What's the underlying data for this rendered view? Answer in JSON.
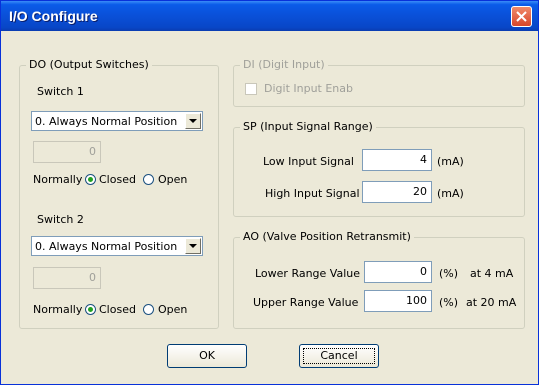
{
  "window": {
    "title": "I/O Configure"
  },
  "do_group": {
    "legend": "DO (Output Switches)",
    "switch1": {
      "label": "Switch 1",
      "selected": "0. Always Normal Position",
      "value": "0"
    },
    "switch2": {
      "label": "Switch 2",
      "selected": "0. Always Normal Position",
      "value": "0"
    },
    "normally_label": "Normally",
    "closed_label": "Closed",
    "open_label": "Open"
  },
  "di_group": {
    "legend": "DI (Digit Input)",
    "checkbox_label": "Digit Input Enab"
  },
  "sp_group": {
    "legend": "SP (Input Signal Range)",
    "low_label": "Low Input Signal",
    "low_value": "4",
    "low_unit": "(mA)",
    "high_label": "High Input Signal",
    "high_value": "20",
    "high_unit": "(mA)"
  },
  "ao_group": {
    "legend": "AO (Valve Position Retransmit)",
    "lower_label": "Lower Range Value",
    "lower_value": "0",
    "lower_unit": "(%)",
    "lower_note": "at 4 mA",
    "upper_label": "Upper Range Value",
    "upper_value": "100",
    "upper_unit": "(%)",
    "upper_note": "at 20 mA"
  },
  "buttons": {
    "ok": "OK",
    "cancel": "Cancel"
  }
}
